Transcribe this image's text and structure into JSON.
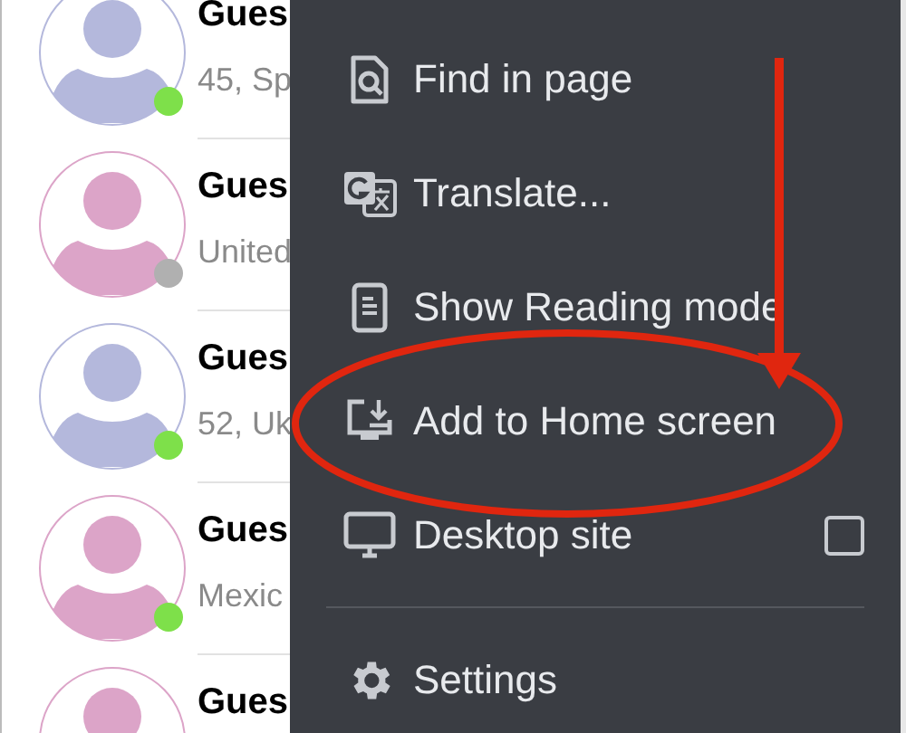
{
  "contacts": [
    {
      "name": "Gues",
      "detail": "45, Sp",
      "color": "#b4b8dc",
      "online": true
    },
    {
      "name": "Gues",
      "detail": "United",
      "color": "#dca4c8",
      "online": false
    },
    {
      "name": "Gues",
      "detail": "52, Uk",
      "color": "#b4b8dc",
      "online": true
    },
    {
      "name": "Gues",
      "detail": "Mexic",
      "color": "#dca4c8",
      "online": true
    },
    {
      "name": "Gues",
      "color": "#dca4c8"
    }
  ],
  "menu": {
    "items": [
      {
        "kind": "find",
        "label": "Find in page"
      },
      {
        "kind": "translate",
        "label": "Translate..."
      },
      {
        "kind": "reading",
        "label": "Show Reading mode"
      },
      {
        "kind": "home",
        "label": "Add to Home screen"
      },
      {
        "kind": "desktop",
        "label": "Desktop site",
        "checked": false
      },
      {
        "kind": "settings",
        "label": "Settings",
        "divider_before": true
      }
    ]
  }
}
